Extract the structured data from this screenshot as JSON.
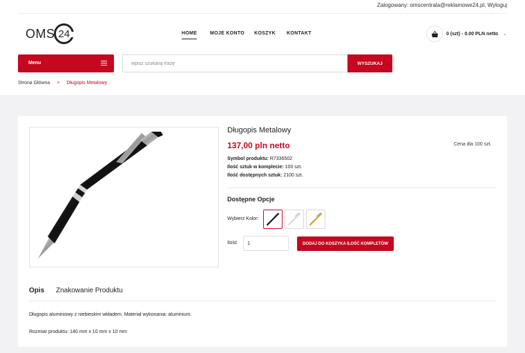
{
  "topbar": {
    "login_text": "Zalogowany: omscentrala@reklamowe24.pl, Wyloguj"
  },
  "logo": {
    "part1": "OMS",
    "part2": "24"
  },
  "nav": {
    "items": [
      {
        "label": "HOME",
        "active": true
      },
      {
        "label": "MOJE KONTO",
        "active": false
      },
      {
        "label": "KOSZYK",
        "active": false
      },
      {
        "label": "KONTAKT",
        "active": false
      }
    ]
  },
  "cart": {
    "summary": "0 (szt) - 0.00 PLN netto"
  },
  "menu": {
    "label": "Menu"
  },
  "search": {
    "placeholder": "wpisz szukaną frazę",
    "button": "WYSZUKAJ"
  },
  "breadcrumb": {
    "home": "Strona Główna",
    "separator": ">",
    "current": "Długopis Metalowy"
  },
  "product": {
    "title": "Długopis Metalowy",
    "price": "137,00 pln netto",
    "price_note": "Cena dla 100 szt.",
    "specs": [
      {
        "label": "Symbol produktu:",
        "value": "R7336502"
      },
      {
        "label": "Ilość sztuk w komplecie:",
        "value": "100 szt."
      },
      {
        "label": "Ilość dostępnych sztuk:",
        "value": "2100 szt."
      }
    ],
    "options_title": "Dostępne Opcje",
    "color_label": "Wybierz Kolor:",
    "colors": [
      "black",
      "white",
      "gold"
    ],
    "qty_label": "Ilość",
    "qty_value": "1",
    "add_button": "DODAJ DO KOSZYKA ILOŚĆ KOMPLETÓW"
  },
  "tabs": [
    {
      "label": "Opis",
      "active": true
    },
    {
      "label": "Znakowanie Produktu",
      "active": false
    }
  ],
  "description": {
    "line1": "Długopis aluminiowy z niebieskim wkładem. Materiał wykonania: aluminium.",
    "line2": "Rozmiar produktu: 140 mm x 10 mm x 10 mm"
  },
  "colors": {
    "accent": "#c5081f",
    "background_grey": "#f2f2f5"
  }
}
